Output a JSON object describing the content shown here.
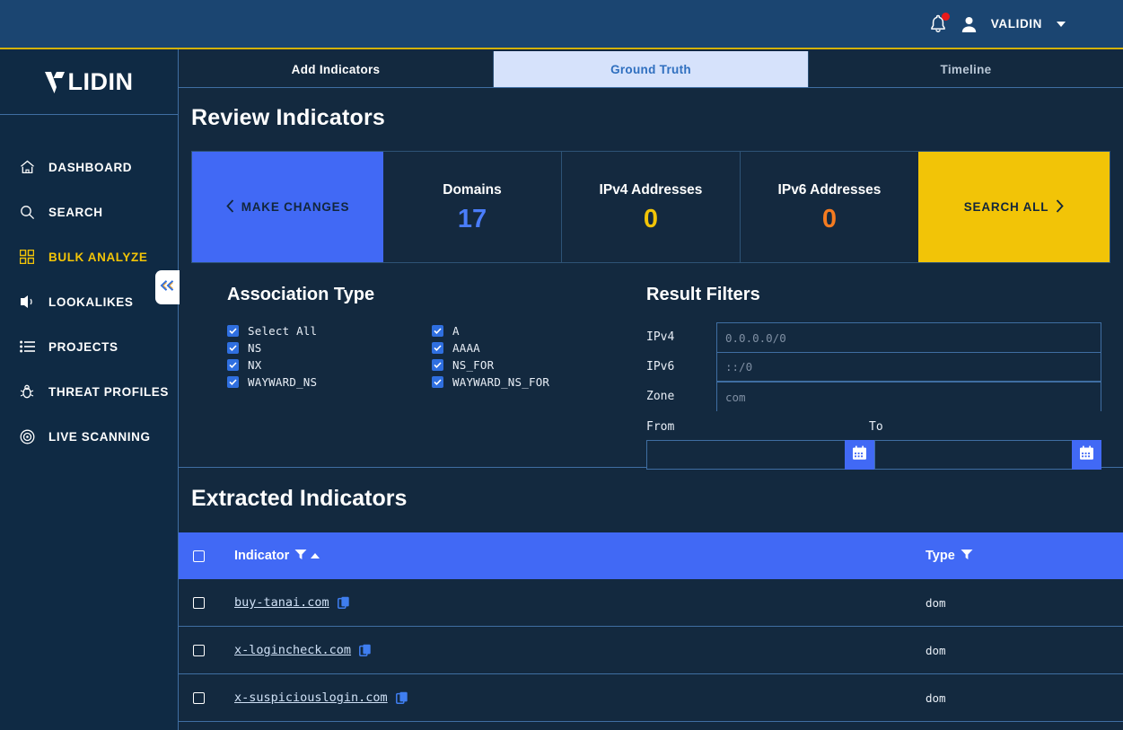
{
  "topbar": {
    "user_name": "VALIDIN",
    "notification_color": "#e8191a",
    "bg_color": "#1b4571"
  },
  "sidebar": {
    "logo": "VALIDIN",
    "logo_prefix": "LIDIN",
    "active_color": "#f2c407",
    "items": [
      {
        "label": "DASHBOARD",
        "icon": "home-icon",
        "active": false
      },
      {
        "label": "SEARCH",
        "icon": "search-icon",
        "active": false
      },
      {
        "label": "BULK ANALYZE",
        "icon": "grid-icon",
        "active": true
      },
      {
        "label": "LOOKALIKES",
        "icon": "lookalikes-icon",
        "active": false
      },
      {
        "label": "PROJECTS",
        "icon": "list-icon",
        "active": false
      },
      {
        "label": "THREAT PROFILES",
        "icon": "bug-icon",
        "active": false
      },
      {
        "label": "LIVE SCANNING",
        "icon": "target-icon",
        "active": false
      }
    ],
    "collapse_icon": "double-chevron-left-icon"
  },
  "tabs": [
    {
      "label": "Add Indicators",
      "active": false
    },
    {
      "label": "Ground Truth",
      "active": true
    },
    {
      "label": "Timeline",
      "active": false,
      "muted": true
    }
  ],
  "page": {
    "title": "Review Indicators"
  },
  "statbar": {
    "make_changes_label": "MAKE CHANGES",
    "search_all_label": "SEARCH ALL",
    "make_changes_color": "#4169f5",
    "search_all_color": "#f2c407",
    "cells": [
      {
        "label": "Domains",
        "value": "17",
        "value_color": "#4a7dfb"
      },
      {
        "label": "IPv4 Addresses",
        "value": "0",
        "value_color": "#f2c407"
      },
      {
        "label": "IPv6 Addresses",
        "value": "0",
        "value_color": "#f47b20"
      }
    ]
  },
  "association_type": {
    "title": "Association Type",
    "column_left": [
      {
        "label": "Select All",
        "checked": true
      },
      {
        "label": "NS",
        "checked": true
      },
      {
        "label": "NX",
        "checked": true
      },
      {
        "label": "WAYWARD_NS",
        "checked": true
      }
    ],
    "column_right": [
      {
        "label": "A",
        "checked": true
      },
      {
        "label": "AAAA",
        "checked": true
      },
      {
        "label": "NS_FOR",
        "checked": true
      },
      {
        "label": "WAYWARD_NS_FOR",
        "checked": true
      }
    ]
  },
  "result_filters": {
    "title": "Result Filters",
    "fields": [
      {
        "label": "IPv4",
        "value": "",
        "placeholder": "0.0.0.0/0"
      },
      {
        "label": "IPv6",
        "value": "",
        "placeholder": "::/0"
      },
      {
        "label": "Zone",
        "value": "",
        "placeholder": "com"
      }
    ],
    "from_label": "From",
    "to_label": "To",
    "from_value": "",
    "to_value": "",
    "from_placeholder": "",
    "to_placeholder": "",
    "calendar_icon": "calendar-icon"
  },
  "extracted": {
    "title": "Extracted Indicators",
    "columns": {
      "indicator": "Indicator",
      "type": "Type"
    },
    "rows": [
      {
        "indicator": "buy-tanai.com",
        "type": "dom"
      },
      {
        "indicator": "x-logincheck.com",
        "type": "dom"
      },
      {
        "indicator": "x-suspiciouslogin.com",
        "type": "dom"
      }
    ]
  }
}
